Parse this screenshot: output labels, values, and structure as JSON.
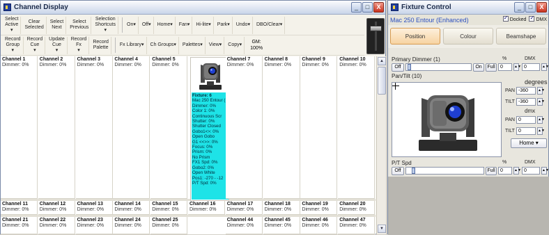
{
  "channel_window": {
    "title": "Channel Display",
    "toolbar_row1": [
      {
        "l1": "Select",
        "l2": "Active",
        "arrow": true
      },
      {
        "l1": "Clear",
        "l2": "Selected"
      },
      {
        "l1": "Select",
        "l2": "Next"
      },
      {
        "l1": "Select",
        "l2": "Previous"
      },
      {
        "l1": "Selection",
        "l2": "Shortcuts",
        "arrow": true
      }
    ],
    "toolbar_row1b": [
      "On",
      "Off",
      "Home",
      "Fan",
      "Hi-lite",
      "Park",
      "Undo",
      "DBO/Clear"
    ],
    "toolbar_row2": [
      {
        "l1": "Record",
        "l2": "Group",
        "arrow": true
      },
      {
        "l1": "Record",
        "l2": "Cue",
        "arrow": true
      },
      {
        "l1": "Update",
        "l2": "Cue",
        "arrow": true
      },
      {
        "l1": "Record",
        "l2": "Fx",
        "arrow": true
      },
      {
        "l1": "Record",
        "l2": "Palette"
      }
    ],
    "toolbar_row2b": [
      "Fx Library",
      "Ch Groups",
      "Palettes",
      "View",
      "Copy"
    ],
    "gm_label": "GM:",
    "gm_value": "100%",
    "channels_top": [
      {
        "name": "Channel 1",
        "dim": "Dimmer: 0%"
      },
      {
        "name": "Channel 2",
        "dim": "Dimmer: 0%"
      },
      {
        "name": "Channel 3",
        "dim": "Dimmer: 0%"
      },
      {
        "name": "Channel 4",
        "dim": "Dimmer: 0%"
      },
      {
        "name": "Channel 5",
        "dim": "Dimmer: 0%"
      },
      {
        "name": "",
        "dim": ""
      },
      {
        "name": "Channel 7",
        "dim": "Dimmer: 0%"
      },
      {
        "name": "Channel 8",
        "dim": "Dimmer: 0%"
      },
      {
        "name": "Channel 9",
        "dim": "Dimmer: 0%"
      },
      {
        "name": "Channel 10",
        "dim": "Dimmer: 0%"
      }
    ],
    "channels_mid": [
      {
        "name": "Channel 11",
        "dim": "Dimmer: 0%"
      },
      {
        "name": "Channel 12",
        "dim": "Dimmer: 0%"
      },
      {
        "name": "Channel 13",
        "dim": "Dimmer: 0%"
      },
      {
        "name": "Channel 14",
        "dim": "Dimmer: 0%"
      },
      {
        "name": "Channel 15",
        "dim": "Dimmer: 0%"
      },
      {
        "name": "Channel 16",
        "dim": "Dimmer: 0%"
      },
      {
        "name": "Channel 17",
        "dim": "Dimmer: 0%"
      },
      {
        "name": "Channel 18",
        "dim": "Dimmer: 0%"
      },
      {
        "name": "Channel 19",
        "dim": "Dimmer: 0%"
      },
      {
        "name": "Channel 20",
        "dim": "Dimmer: 0%"
      }
    ],
    "channels_bot": [
      {
        "name": "Channel 21",
        "dim": "Dimmer: 0%"
      },
      {
        "name": "Channel 22",
        "dim": "Dimmer: 0%"
      },
      {
        "name": "Channel 23",
        "dim": "Dimmer: 0%"
      },
      {
        "name": "Channel 24",
        "dim": "Dimmer: 0%"
      },
      {
        "name": "Channel 25",
        "dim": "Dimmer: 0%"
      },
      {
        "name": "",
        "dim": ""
      },
      {
        "name": "Channel 44",
        "dim": "Dimmer: 0%"
      },
      {
        "name": "Channel 45",
        "dim": "Dimmer: 0%"
      },
      {
        "name": "Channel 46",
        "dim": "Dimmer: 0%"
      },
      {
        "name": "Channel 47",
        "dim": "Dimmer: 0%"
      }
    ],
    "fixture_info": {
      "title": "Fixture: 6",
      "lines": [
        "Mac 250 Entour (",
        "Dimmer: 0%",
        "Color 1: 0%",
        "  Continuous Scr",
        "Shutter: 0%",
        "  Shutter Closed",
        "Gobo1<>: 0%",
        "  Open Gobo",
        "G1 <<>>: 0%",
        "Focus: 0%",
        "Prism: 0%",
        "  No Prism",
        "FX1 Spd: 0%",
        "Gobo2: 0%",
        "  Open White",
        "Pos1: -270 - -12",
        "P/T Spd: 0%"
      ]
    },
    "accent_cyan": "#1ee3e7"
  },
  "fixture_window": {
    "title": "Fixture Control",
    "fixture_name": "Mac 250 Entour (Enhanced)",
    "docked_label": "Docked",
    "dmx_check_label": "DMX",
    "tabs": [
      "Position",
      "Colour",
      "Beamshape"
    ],
    "active_tab": "Position",
    "primary_dimmer": {
      "label": "Primary Dimmer (1)",
      "pct_label": "%",
      "dmx_label": "DMX",
      "off": "Off",
      "on": "On",
      "full": "Full",
      "pct": "0",
      "dmx": "0"
    },
    "pantilt_label": "Pan/Tilt (10)",
    "degrees_label": "degrees",
    "dmx_sub_label": "dmx",
    "pan_label": "PAN",
    "tilt_label": "TILT",
    "pan_deg": "-360",
    "tilt_deg": "-360",
    "pan_dmx": "0",
    "tilt_dmx": "0",
    "home_label": "Home",
    "pt_spd": {
      "label": "P/T Spd",
      "pct_label": "%",
      "dmx_label": "DMX",
      "off": "Off",
      "full": "Full",
      "pct": "0",
      "dmx": "0"
    }
  },
  "window_buttons": {
    "min": "_",
    "max": "□",
    "close": "X"
  }
}
